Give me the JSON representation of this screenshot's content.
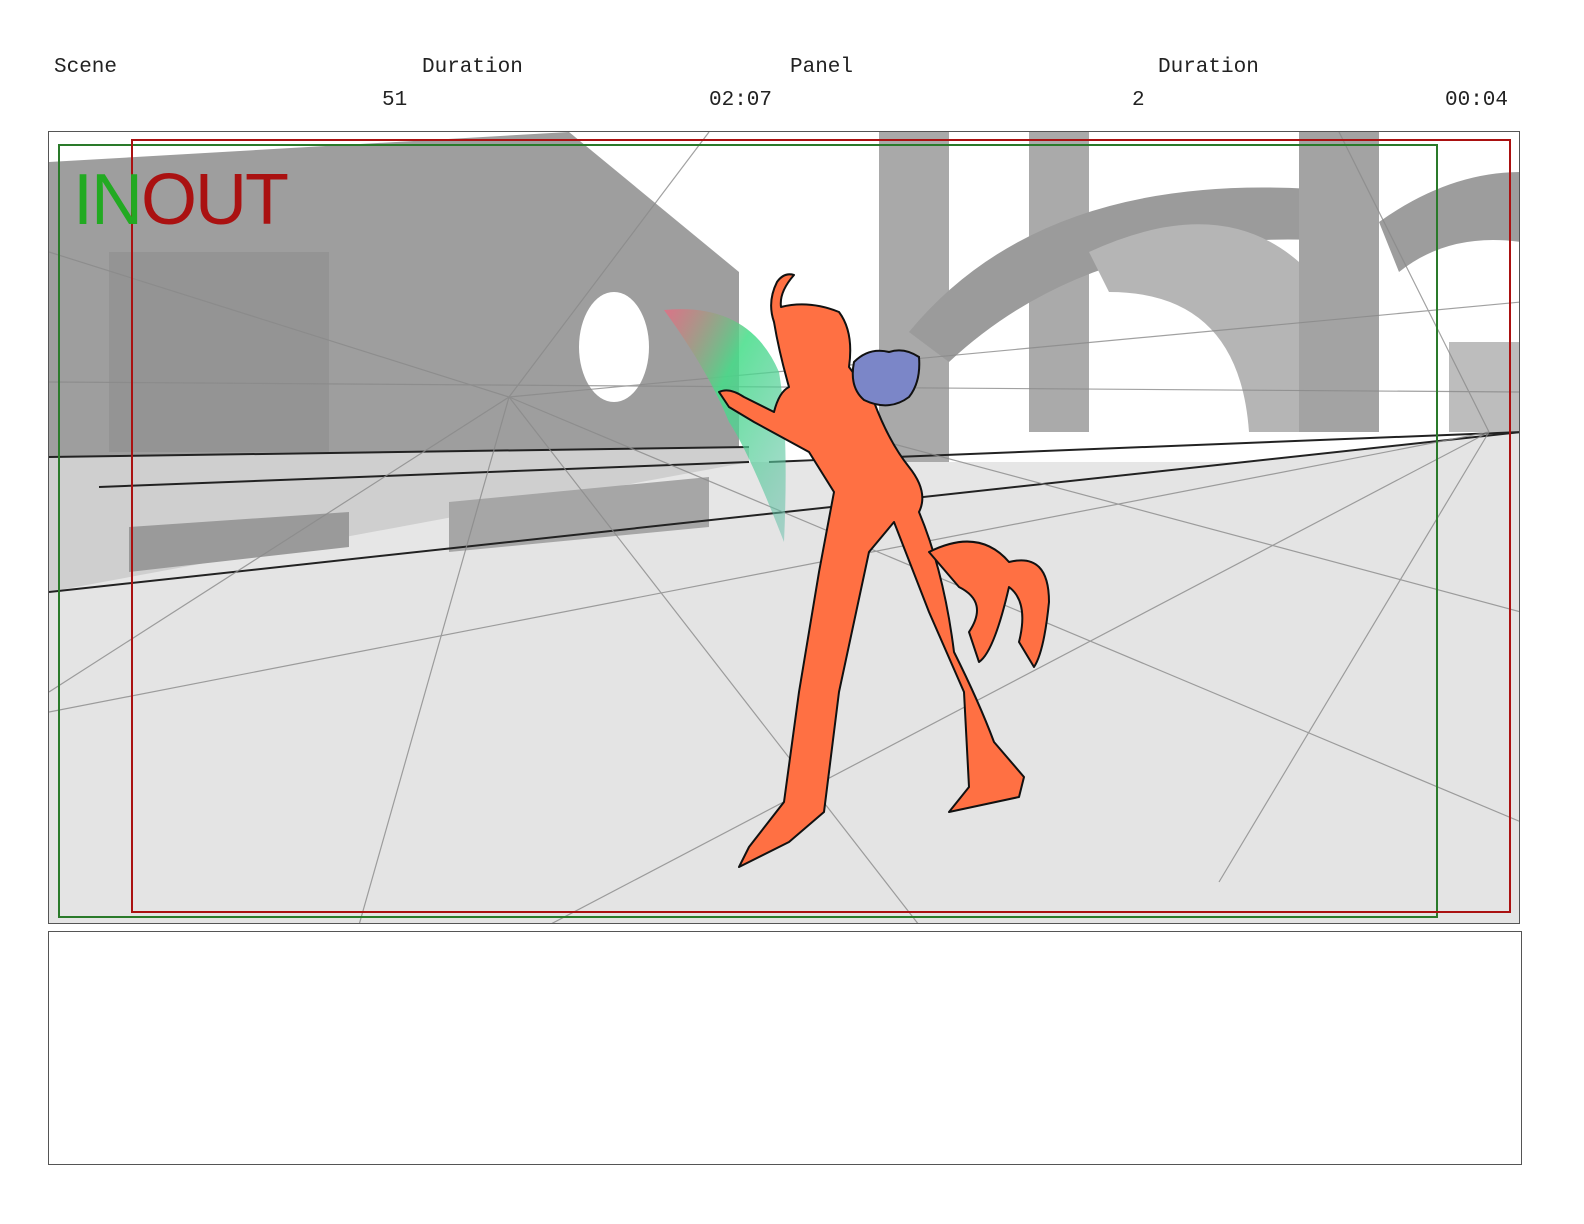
{
  "header": {
    "scene_label": "Scene",
    "scene_duration_label": "Duration",
    "panel_label": "Panel",
    "panel_duration_label": "Duration",
    "scene_number": "51",
    "scene_duration": "02:07",
    "panel_number": "2",
    "panel_duration": "00:04"
  },
  "overlay": {
    "in_label": "IN",
    "out_label": "OUT"
  },
  "colors": {
    "in_frame": "#2a7a2a",
    "out_frame": "#aa1111",
    "character_fill": "#ff7043",
    "creature_fill": "#7b86c8"
  }
}
